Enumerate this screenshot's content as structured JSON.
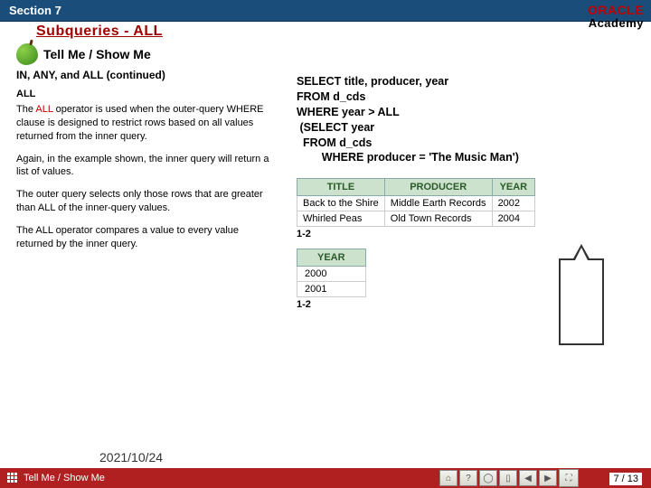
{
  "section_bar": "Section 7",
  "slide_title": "Subqueries - ALL",
  "logo": {
    "line1": "ORACLE",
    "line2": "Academy"
  },
  "tellme_label": "Tell Me / Show Me",
  "left": {
    "subhead1": "IN, ANY, and ALL (continued)",
    "subhead2": "ALL",
    "p1a": "The ",
    "p1_red": "ALL",
    "p1b": " operator is used when the outer-query WHERE clause is designed to restrict rows based on all values returned from the inner query.",
    "p2": "Again, in the example shown, the inner query will return a list of values.",
    "p3": "The outer query selects only those rows that are greater than ALL of the inner-query values.",
    "p4": "The ALL operator compares a value to every value returned by the inner query."
  },
  "sql": "SELECT title, producer, year\nFROM d_cds\nWHERE year > ALL\n (SELECT year\n  FROM d_cds\n        WHERE producer = 'The Music Man')",
  "table1": {
    "headers": [
      "TITLE",
      "PRODUCER",
      "YEAR"
    ],
    "rows": [
      [
        "Back to the Shire",
        "Middle Earth Records",
        "2002"
      ],
      [
        "Whirled Peas",
        "Old Town Records",
        "2004"
      ]
    ],
    "rowcount": "1-2"
  },
  "table2": {
    "header": "YEAR",
    "rows": [
      "2000",
      "2001"
    ],
    "rowcount": "1-2"
  },
  "date": "2021/10/24",
  "footer_label": "Tell Me / Show Me",
  "page": "7 / 13"
}
